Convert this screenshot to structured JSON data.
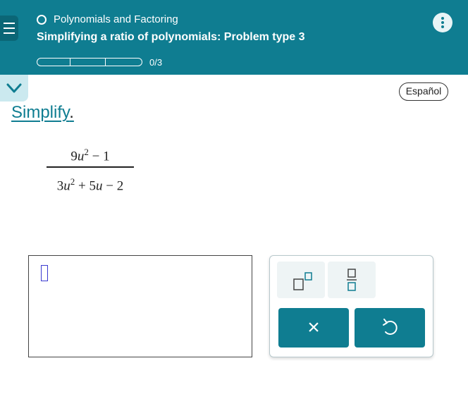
{
  "header": {
    "topic": "Polynomials and Factoring",
    "problem_title": "Simplifying a ratio of polynomials: Problem type 3",
    "progress_text": "0/3",
    "progress": 0
  },
  "language_button": "Español",
  "prompt": {
    "label": "Simplify",
    "period": "."
  },
  "expression": {
    "num": {
      "coef": "9",
      "var": "u",
      "exp": "2",
      "rest": " − 1"
    },
    "den": {
      "coef": "3",
      "var": "u",
      "exp": "2",
      "rest_op1": " + 5",
      "var2": "u",
      "rest_op2": " − 2"
    }
  },
  "keypad": {
    "clear_symbol": "×",
    "undo_symbol": "↺"
  },
  "colors": {
    "brand": "#0f7d91",
    "brand_dark": "#0b6676",
    "cursor": "#3b3bd0"
  },
  "icons": [
    "menu-icon",
    "kebab-menu-icon",
    "chevron-down-icon",
    "exponent-icon",
    "fraction-icon",
    "clear-icon",
    "undo-icon"
  ]
}
